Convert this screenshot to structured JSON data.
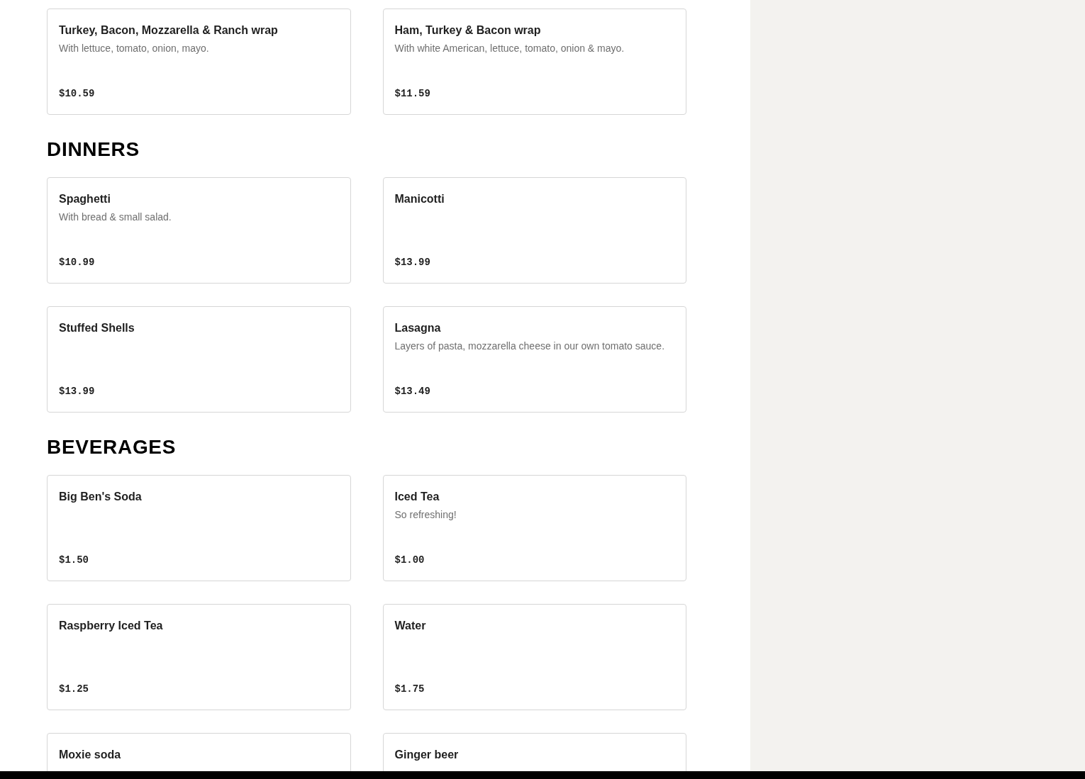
{
  "sections": [
    {
      "items": [
        {
          "name": "Turkey, Bacon, Mozzarella & Ranch wrap",
          "description": "With lettuce, tomato, onion, mayo.",
          "price": "$10.59"
        },
        {
          "name": "Ham, Turkey & Bacon wrap",
          "description": "With white American, lettuce, tomato, onion & mayo.",
          "price": "$11.59"
        }
      ]
    },
    {
      "title": "DINNERS",
      "items": [
        {
          "name": "Spaghetti",
          "description": "With bread & small salad.",
          "price": "$10.99"
        },
        {
          "name": "Manicotti",
          "price": "$13.99"
        },
        {
          "name": "Stuffed Shells",
          "price": "$13.99"
        },
        {
          "name": "Lasagna",
          "description": "Layers of pasta, mozzarella cheese in our own tomato sauce.",
          "price": "$13.49"
        }
      ]
    },
    {
      "title": "BEVERAGES",
      "items": [
        {
          "name": "Big Ben's Soda",
          "price": "$1.50"
        },
        {
          "name": "Iced Tea",
          "description": "So refreshing!",
          "price": "$1.00"
        },
        {
          "name": "Raspberry Iced Tea",
          "price": "$1.25"
        },
        {
          "name": "Water",
          "price": "$1.75"
        },
        {
          "name": "Moxie soda"
        },
        {
          "name": "Ginger beer"
        }
      ]
    }
  ]
}
